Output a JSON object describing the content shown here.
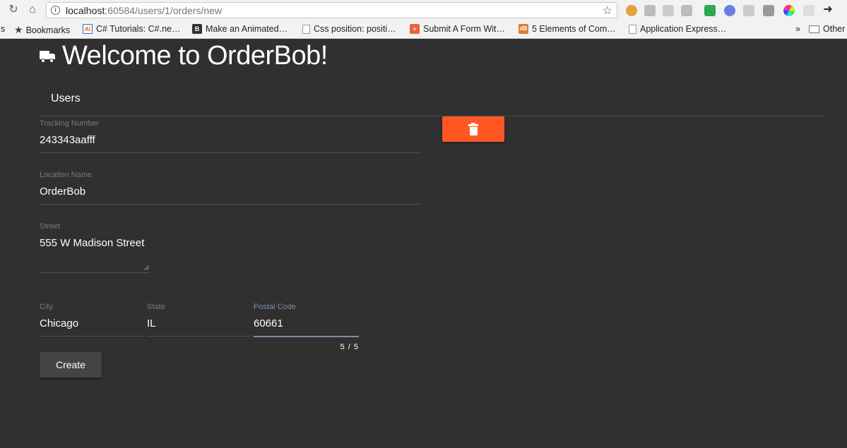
{
  "browser": {
    "url_host": "localhost",
    "url_path": ":60584/users/1/orders/new",
    "bookmarks": [
      {
        "label": "s",
        "icon": "cut-off"
      },
      {
        "label": "Bookmarks",
        "icon": "star-icon"
      },
      {
        "label": "C# Tutorials: C#.ne…",
        "icon": "ai-icon"
      },
      {
        "label": "Make an Animated…",
        "icon": "b-icon"
      },
      {
        "label": "Css position: positi…",
        "icon": "page-icon"
      },
      {
        "label": "Submit A Form Wit…",
        "icon": "plus-icon"
      },
      {
        "label": "5 Elements of Com…",
        "icon": "db-icon"
      },
      {
        "label": "Application Express…",
        "icon": "page-icon"
      },
      {
        "label": "»",
        "icon": "chevron"
      },
      {
        "label": "Other",
        "icon": "folder-icon"
      }
    ]
  },
  "app": {
    "title": "Welcome to OrderBob!",
    "nav_users": "Users"
  },
  "form": {
    "tracking_label": "Tracking Number",
    "tracking_value": "243343aafff",
    "location_label": "Location Name",
    "location_value": "OrderBob",
    "street_label": "Street",
    "street_value": "555 W Madison Street",
    "city_label": "City",
    "city_value": "Chicago",
    "state_label": "State",
    "state_value": "IL",
    "postal_label": "Postal Code",
    "postal_value": "60661",
    "postal_counter": "5 / 5",
    "create_label": "Create"
  },
  "colors": {
    "background": "#303030",
    "delete_button": "#ff5722",
    "create_button": "#444444",
    "postal_focus": "#7a8fa6"
  }
}
